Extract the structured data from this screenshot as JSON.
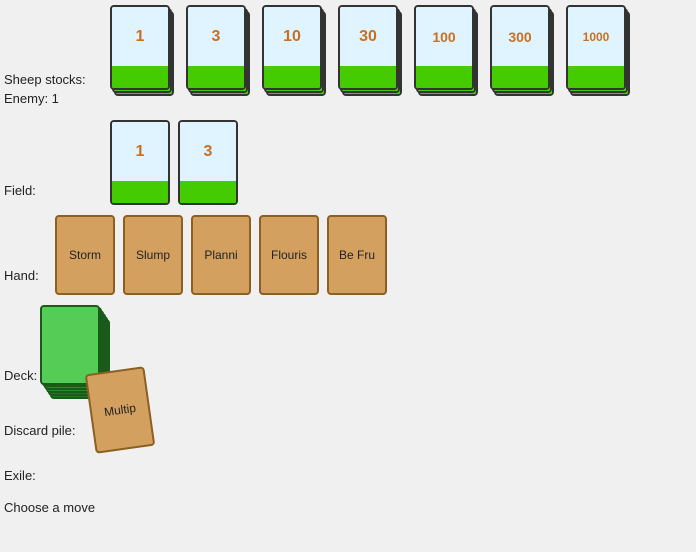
{
  "labels": {
    "sheep_stocks": "Sheep stocks:",
    "enemy": "Enemy: 1",
    "field": "Field:",
    "hand": "Hand:",
    "deck": "Deck:",
    "discard_pile": "Discard pile:",
    "exile": "Exile:",
    "choose_move": "Choose a move"
  },
  "sheep_stocks": [
    {
      "value": "1"
    },
    {
      "value": "3"
    },
    {
      "value": "10"
    },
    {
      "value": "30"
    },
    {
      "value": "100"
    },
    {
      "value": "300"
    },
    {
      "value": "1000"
    }
  ],
  "field_cards": [
    {
      "value": "1"
    },
    {
      "value": "3"
    }
  ],
  "hand_cards": [
    {
      "label": "Storm"
    },
    {
      "label": "Slump"
    },
    {
      "label": "Planni"
    },
    {
      "label": "Flouris"
    },
    {
      "label": "Be Fru"
    }
  ],
  "discard_cards": [
    {
      "label": "Multip"
    }
  ],
  "colors": {
    "card_bg": "#ffffff",
    "card_top_bg": "#e0f4ff",
    "card_green": "#44cc00",
    "hand_card_bg": "#d4a060",
    "hand_card_border": "#8b6020",
    "deck_bg": "#2a8a2a",
    "deck_dark": "#2a6a2a",
    "deck_light": "#55cc55",
    "text_value": "#c87020"
  }
}
